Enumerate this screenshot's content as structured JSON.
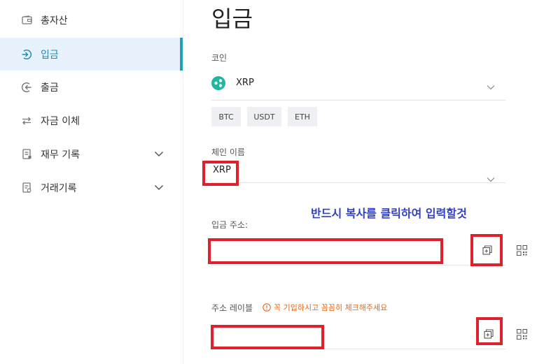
{
  "sidebar": {
    "items": [
      {
        "label": "총자산",
        "icon": "wallet-icon"
      },
      {
        "label": "입금",
        "icon": "deposit-icon"
      },
      {
        "label": "출금",
        "icon": "withdraw-icon"
      },
      {
        "label": "자금 이체",
        "icon": "transfer-icon"
      },
      {
        "label": "재무 기록",
        "icon": "document-icon"
      },
      {
        "label": "거래기록",
        "icon": "document-list-icon"
      }
    ],
    "active_color": "#1f8ab8",
    "active_indicator_color": "#20a0b4"
  },
  "main": {
    "title": "입금",
    "coin": {
      "label": "코인",
      "selected": "XRP",
      "quick_options": [
        "BTC",
        "USDT",
        "ETH"
      ]
    },
    "chain": {
      "label": "체인 이름",
      "selected": "XRP"
    },
    "notice": "반드시 복사를 클릭하여 입력할것",
    "address": {
      "label": "입금 주소:",
      "value": ""
    },
    "memo": {
      "label": "주소 레이블",
      "warning": "꼭 기입하시고 꼼꼼히 체크해주세요",
      "value": ""
    }
  },
  "colors": {
    "highlight_red": "#e0202a",
    "notice_blue": "#2f3fc7",
    "warning_orange": "#e06a1a",
    "xrp_teal": "#1fb6a4"
  }
}
